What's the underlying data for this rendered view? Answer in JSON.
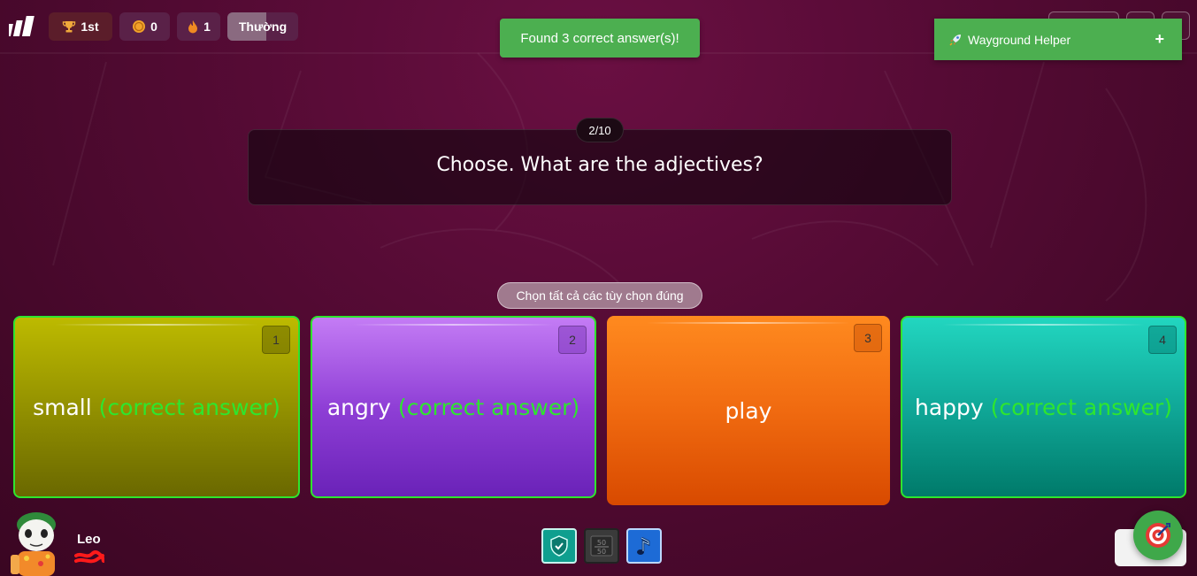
{
  "topbar": {
    "rank": "1st",
    "coins": "0",
    "streak": "1",
    "mode": "Thường",
    "mode_progress": 0.55
  },
  "toast": {
    "message": "Found 3 correct answer(s)!"
  },
  "helper": {
    "title": "Wayground Helper",
    "expand_label": "+"
  },
  "question": {
    "counter": "2/10",
    "text": "Choose. What are the adjectives?",
    "hint": "Chọn tất cả các tùy chọn đúng"
  },
  "options": [
    {
      "number": "1",
      "text": "small",
      "correct_tag": "(correct answer)",
      "color": "#bdba00"
    },
    {
      "number": "2",
      "text": "angry",
      "correct_tag": "(correct answer)",
      "color": "#8f3fd6"
    },
    {
      "number": "3",
      "text": "play",
      "correct_tag": "",
      "color": "#f06a10"
    },
    {
      "number": "4",
      "text": "happy",
      "correct_tag": "(correct answer)",
      "color": "#10a898"
    }
  ],
  "player": {
    "name": "Leo"
  },
  "powerups": [
    {
      "icon": "shield-check-icon"
    },
    {
      "icon": "fifty-fifty-icon",
      "label": "50/50"
    },
    {
      "icon": "music-note-icon"
    }
  ],
  "colors": {
    "background": "#560b35",
    "correct_highlight": "#2ee62e",
    "toast": "#4caf50"
  }
}
